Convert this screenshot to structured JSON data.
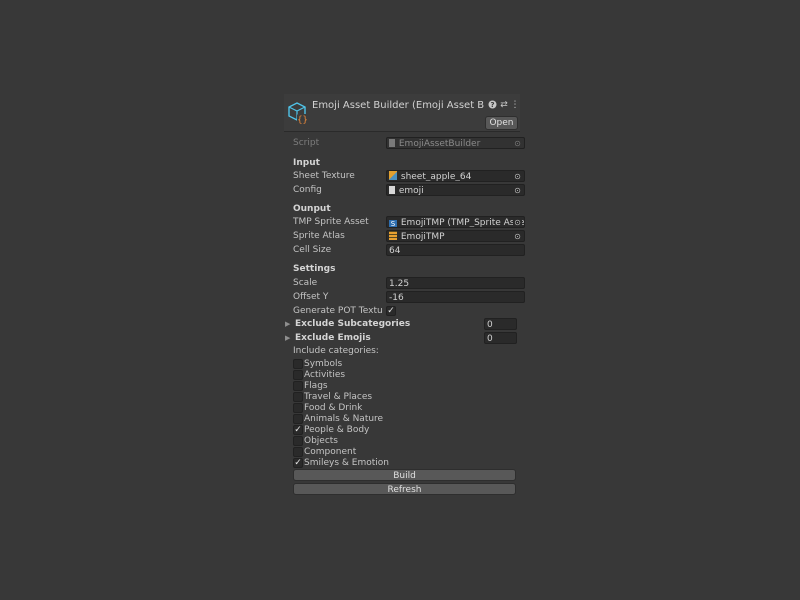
{
  "header": {
    "title": "Emoji Asset Builder (Emoji Asset Builder)",
    "icon": "script-cube-icon",
    "help_icon": "?",
    "settings_icon": "⇄",
    "menu_icon": "⋮",
    "open_label": "Open"
  },
  "script": {
    "label": "Script",
    "value": "EmojiAssetBuilder"
  },
  "input": {
    "title": "Input",
    "sheet_texture": {
      "label": "Sheet Texture",
      "value": "sheet_apple_64"
    },
    "config": {
      "label": "Config",
      "value": "emoji"
    }
  },
  "output": {
    "title": "Ounput",
    "tmp_sprite_asset": {
      "label": "TMP Sprite Asset",
      "value": "EmojiTMP (TMP_Sprite Asset)"
    },
    "sprite_atlas": {
      "label": "Sprite Atlas",
      "value": "EmojiTMP"
    },
    "cell_size": {
      "label": "Cell Size",
      "value": "64"
    }
  },
  "settings": {
    "title": "Settings",
    "scale": {
      "label": "Scale",
      "value": "1.25"
    },
    "offset_y": {
      "label": "Offset Y",
      "value": "-16"
    },
    "generate_pot": {
      "label": "Generate POT Textu",
      "checked": true
    },
    "exclude_subcategories": {
      "label": "Exclude Subcategories",
      "value": "0"
    },
    "exclude_emojis": {
      "label": "Exclude Emojis",
      "value": "0"
    },
    "include_label": "Include categories:"
  },
  "categories": [
    {
      "label": "Symbols",
      "checked": false
    },
    {
      "label": "Activities",
      "checked": false
    },
    {
      "label": "Flags",
      "checked": false
    },
    {
      "label": "Travel & Places",
      "checked": false
    },
    {
      "label": "Food & Drink",
      "checked": false
    },
    {
      "label": "Animals & Nature",
      "checked": false
    },
    {
      "label": "People & Body",
      "checked": true
    },
    {
      "label": "Objects",
      "checked": false
    },
    {
      "label": "Component",
      "checked": false
    },
    {
      "label": "Smileys & Emotion",
      "checked": true
    }
  ],
  "buttons": {
    "build": "Build",
    "refresh": "Refresh"
  },
  "colors": {
    "background": "#383838",
    "field": "#2a2a2a",
    "button": "#585858",
    "icon_blue": "#4fc3e8",
    "icon_orange": "#e8883a"
  }
}
